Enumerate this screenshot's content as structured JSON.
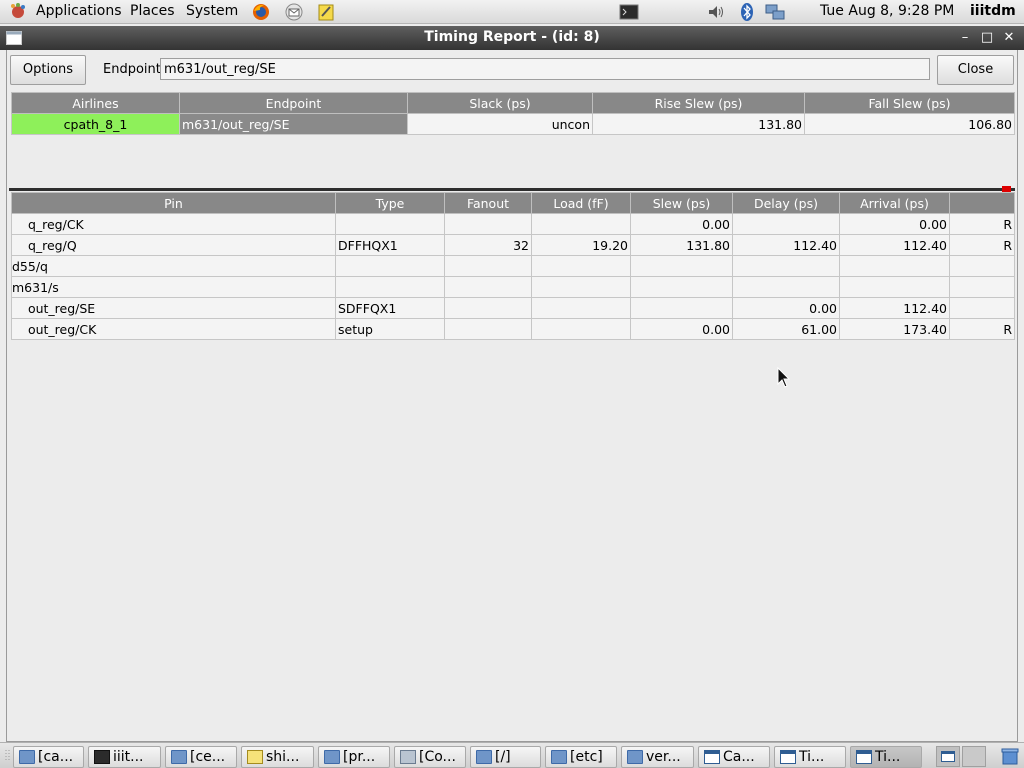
{
  "top_panel": {
    "menus": [
      "Applications",
      "Places",
      "System"
    ],
    "clock": "Tue Aug  8,  9:28 PM",
    "user": "iiitdm",
    "icons": [
      "gnome-foot-icon",
      "firefox-icon",
      "mail-icon",
      "notes-icon",
      "terminal-icon",
      "volume-icon",
      "bluetooth-icon",
      "network-icon"
    ]
  },
  "window": {
    "title": "Timing Report - (id: 8)",
    "options_label": "Options",
    "endpoint_label": "Endpoint:",
    "endpoint_value": "m631/out_reg/SE",
    "close_label": "Close"
  },
  "summary_table": {
    "headers": [
      "Airlines",
      "Endpoint",
      "Slack (ps)",
      "Rise Slew (ps)",
      "Fall Slew (ps)"
    ],
    "rows": [
      {
        "path": "cpath_8_1",
        "endpoint": "m631/out_reg/SE",
        "slack": "uncon",
        "rise_slew": "131.80",
        "fall_slew": "106.80"
      }
    ]
  },
  "detail_table": {
    "headers": [
      "Pin",
      "Type",
      "Fanout",
      "Load (fF)",
      "Slew (ps)",
      "Delay (ps)",
      "Arrival (ps)",
      ""
    ],
    "rows": [
      {
        "pin": "  q_reg/CK",
        "type": "",
        "fanout": "",
        "load": "",
        "slew": "0.00",
        "delay": "",
        "arrival": "0.00",
        "edge": "R"
      },
      {
        "pin": "  q_reg/Q",
        "type": "DFFHQX1",
        "fanout": "32",
        "load": "19.20",
        "slew": "131.80",
        "delay": "112.40",
        "arrival": "112.40",
        "edge": "R"
      },
      {
        "pin": "d55/q",
        "type": "",
        "fanout": "",
        "load": "",
        "slew": "",
        "delay": "",
        "arrival": "",
        "edge": ""
      },
      {
        "pin": "m631/s",
        "type": "",
        "fanout": "",
        "load": "",
        "slew": "",
        "delay": "",
        "arrival": "",
        "edge": ""
      },
      {
        "pin": "  out_reg/SE",
        "type": "SDFFQX1",
        "fanout": "",
        "load": "",
        "slew": "",
        "delay": "0.00",
        "arrival": "112.40",
        "edge": ""
      },
      {
        "pin": "  out_reg/CK",
        "type": "setup",
        "fanout": "",
        "load": "",
        "slew": "0.00",
        "delay": "61.00",
        "arrival": "173.40",
        "edge": "R"
      }
    ]
  },
  "taskbar": {
    "tasks": [
      {
        "label": "[ca...",
        "icon": "folder-icon"
      },
      {
        "label": "iiit...",
        "icon": "terminal-icon"
      },
      {
        "label": "[ce...",
        "icon": "folder-icon"
      },
      {
        "label": "shi...",
        "icon": "text-editor-icon"
      },
      {
        "label": "[pr...",
        "icon": "folder-icon"
      },
      {
        "label": "[Co...",
        "icon": "computer-icon"
      },
      {
        "label": "[/]",
        "icon": "folder-icon"
      },
      {
        "label": "[etc]",
        "icon": "folder-icon"
      },
      {
        "label": "ver...",
        "icon": "folder-icon"
      },
      {
        "label": "Ca...",
        "icon": "window-icon"
      },
      {
        "label": "Ti...",
        "icon": "window-icon"
      },
      {
        "label": "Ti...",
        "icon": "window-icon"
      }
    ]
  }
}
